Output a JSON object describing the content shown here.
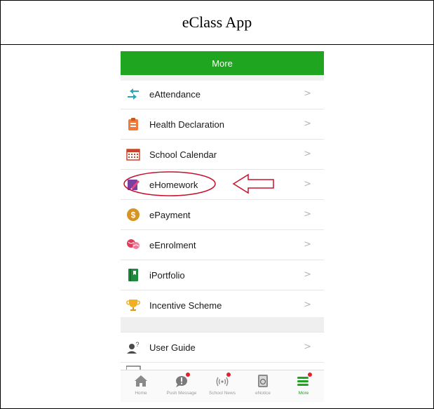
{
  "document": {
    "title": "eClass App"
  },
  "header": {
    "title": "More"
  },
  "menu": {
    "items": [
      {
        "label": "eAttendance",
        "icon": "arrows-exchange-icon"
      },
      {
        "label": "Health Declaration",
        "icon": "clipboard-health-icon"
      },
      {
        "label": "School Calendar",
        "icon": "calendar-icon"
      },
      {
        "label": "eHomework",
        "icon": "homework-pencil-icon"
      },
      {
        "label": "ePayment",
        "icon": "dollar-coin-icon"
      },
      {
        "label": "eEnrolment",
        "icon": "enrolment-balls-icon"
      },
      {
        "label": "iPortfolio",
        "icon": "portfolio-book-icon"
      },
      {
        "label": "Incentive Scheme",
        "icon": "trophy-icon"
      }
    ],
    "guide": {
      "label": "User Guide",
      "icon": "user-help-icon"
    },
    "chevron": ">"
  },
  "tabs": [
    {
      "label": "Home",
      "icon": "home-icon"
    },
    {
      "label": "Push Message",
      "icon": "push-message-icon"
    },
    {
      "label": "School News",
      "icon": "broadcast-icon"
    },
    {
      "label": "eNotice",
      "icon": "notice-icon"
    },
    {
      "label": "More",
      "icon": "menu-more-icon"
    }
  ],
  "colors": {
    "header": "#1fa51f",
    "annotation": "#c8102e",
    "badge": "#e0202a"
  }
}
